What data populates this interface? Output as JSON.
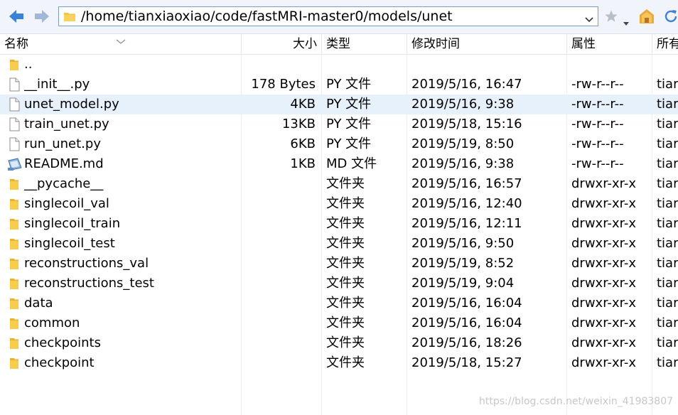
{
  "address": {
    "path": "/home/tianxiaoxiao/code/fastMRI-master0/models/unet"
  },
  "toolbar": {
    "back_icon": "back-arrow-icon",
    "forward_icon": "forward-arrow-icon",
    "bookmark_icon": "star-icon",
    "home_icon": "home-icon",
    "refresh_icon": "refresh-icon"
  },
  "columns": {
    "name": "名称",
    "size": "大小",
    "type": "类型",
    "modified": "修改时间",
    "attributes": "属性",
    "owner": "所有"
  },
  "files": [
    {
      "name": "..",
      "size": "",
      "type": "",
      "modified": "",
      "attributes": "",
      "owner": "",
      "icon": "parent-folder-icon"
    },
    {
      "name": "__init__.py",
      "size": "178 Bytes",
      "type": "PY 文件",
      "modified": "2019/5/16, 16:47",
      "attributes": "-rw-r--r--",
      "owner": "tiar",
      "icon": "file-icon"
    },
    {
      "name": "unet_model.py",
      "size": "4KB",
      "type": "PY 文件",
      "modified": "2019/5/16, 9:38",
      "attributes": "-rw-r--r--",
      "owner": "tiar",
      "icon": "file-icon"
    },
    {
      "name": "train_unet.py",
      "size": "13KB",
      "type": "PY 文件",
      "modified": "2019/5/18, 15:16",
      "attributes": "-rw-r--r--",
      "owner": "tiar",
      "icon": "file-icon"
    },
    {
      "name": "run_unet.py",
      "size": "6KB",
      "type": "PY 文件",
      "modified": "2019/5/19, 8:50",
      "attributes": "-rw-r--r--",
      "owner": "tiar",
      "icon": "file-icon"
    },
    {
      "name": "README.md",
      "size": "1KB",
      "type": "MD 文件",
      "modified": "2019/5/16, 9:38",
      "attributes": "-rw-r--r--",
      "owner": "tiar",
      "icon": "markdown-file-icon"
    },
    {
      "name": "__pycache__",
      "size": "",
      "type": "文件夹",
      "modified": "2019/5/16, 16:57",
      "attributes": "drwxr-xr-x",
      "owner": "tiar",
      "icon": "folder-icon"
    },
    {
      "name": "singlecoil_val",
      "size": "",
      "type": "文件夹",
      "modified": "2019/5/16, 12:40",
      "attributes": "drwxr-xr-x",
      "owner": "tiar",
      "icon": "folder-icon"
    },
    {
      "name": "singlecoil_train",
      "size": "",
      "type": "文件夹",
      "modified": "2019/5/16, 12:11",
      "attributes": "drwxr-xr-x",
      "owner": "tiar",
      "icon": "folder-icon"
    },
    {
      "name": "singlecoil_test",
      "size": "",
      "type": "文件夹",
      "modified": "2019/5/16, 9:50",
      "attributes": "drwxr-xr-x",
      "owner": "tiar",
      "icon": "folder-icon"
    },
    {
      "name": "reconstructions_val",
      "size": "",
      "type": "文件夹",
      "modified": "2019/5/19, 8:52",
      "attributes": "drwxr-xr-x",
      "owner": "tiar",
      "icon": "folder-icon"
    },
    {
      "name": "reconstructions_test",
      "size": "",
      "type": "文件夹",
      "modified": "2019/5/19, 9:04",
      "attributes": "drwxr-xr-x",
      "owner": "tiar",
      "icon": "folder-icon"
    },
    {
      "name": "data",
      "size": "",
      "type": "文件夹",
      "modified": "2019/5/16, 16:04",
      "attributes": "drwxr-xr-x",
      "owner": "tiar",
      "icon": "folder-icon"
    },
    {
      "name": "common",
      "size": "",
      "type": "文件夹",
      "modified": "2019/5/16, 16:04",
      "attributes": "drwxr-xr-x",
      "owner": "tiar",
      "icon": "folder-icon"
    },
    {
      "name": "checkpoints",
      "size": "",
      "type": "文件夹",
      "modified": "2019/5/16, 18:26",
      "attributes": "drwxr-xr-x",
      "owner": "tiar",
      "icon": "folder-icon"
    },
    {
      "name": "checkpoint",
      "size": "",
      "type": "文件夹",
      "modified": "2019/5/18, 15:27",
      "attributes": "drwxr-xr-x",
      "owner": "tiar",
      "icon": "folder-icon"
    }
  ],
  "selected_index": 2,
  "watermark": "https://blog.csdn.net/weixin_41983807",
  "colors": {
    "folder": "#f5c343",
    "selection": "#e6f1fb",
    "accent_blue": "#2f7fd8"
  }
}
